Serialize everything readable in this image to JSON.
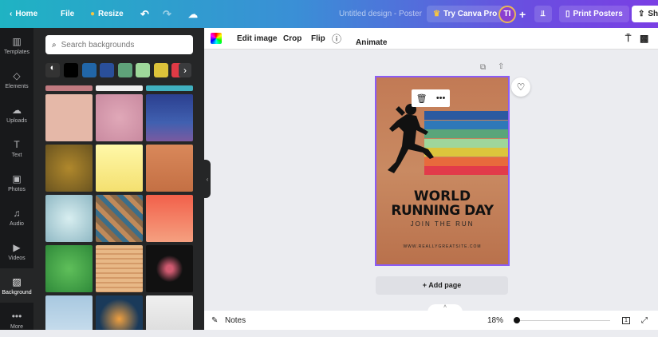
{
  "topbar": {
    "home": "Home",
    "file": "File",
    "resize": "Resize",
    "title": "Untitled design - Poster",
    "try_pro": "Try Canva Pro",
    "avatar": "TI",
    "print": "Print Posters",
    "share": "Sh"
  },
  "rail": [
    {
      "label": "Templates",
      "icon": "▥"
    },
    {
      "label": "Elements",
      "icon": "◇"
    },
    {
      "label": "Uploads",
      "icon": "☁"
    },
    {
      "label": "Text",
      "icon": "T"
    },
    {
      "label": "Photos",
      "icon": "▣"
    },
    {
      "label": "Audio",
      "icon": "♫"
    },
    {
      "label": "Videos",
      "icon": "▶"
    },
    {
      "label": "Background",
      "icon": "▨"
    },
    {
      "label": "More",
      "icon": "•••"
    }
  ],
  "panel": {
    "search_placeholder": "Search backgrounds",
    "swatches": [
      "#000000",
      "#2166a8",
      "#2a4f9a",
      "#5fa37a",
      "#9ed89a",
      "#dcc23a",
      "#e03a45"
    ]
  },
  "toolbar": {
    "edit_image": "Edit image",
    "crop": "Crop",
    "flip": "Flip",
    "animate": "Animate"
  },
  "poster": {
    "title1": "WORLD",
    "title2": "RUNNING DAY",
    "subtitle": "JOIN THE RUN",
    "url": "WWW.REALLYGREATSITE.COM",
    "stripes": [
      "#2c5aa0",
      "#2f78b8",
      "#5aa57a",
      "#9fd69a",
      "#dcc53c",
      "#e86a3c",
      "#e23b4a"
    ]
  },
  "canvas": {
    "add_page": "+ Add page"
  },
  "bottom": {
    "notes": "Notes",
    "zoom": "18%",
    "page": "1"
  }
}
